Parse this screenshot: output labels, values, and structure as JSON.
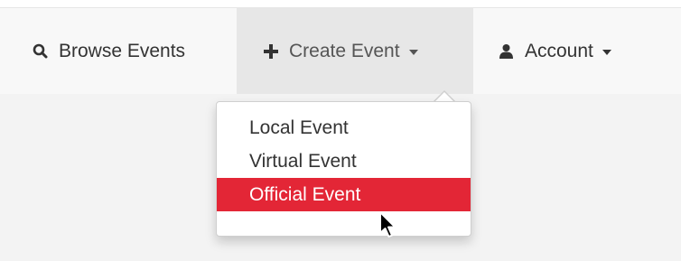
{
  "navbar": {
    "items": [
      {
        "label": "Browse Events",
        "icon": "search-icon"
      },
      {
        "label": "Create Event",
        "icon": "plus-icon"
      },
      {
        "label": "Account",
        "icon": "user-icon"
      }
    ]
  },
  "dropdown": {
    "items": [
      {
        "label": "Local Event"
      },
      {
        "label": "Virtual Event"
      },
      {
        "label": "Official Event",
        "state": "highlighted"
      }
    ]
  },
  "colors": {
    "highlight": "#e32636",
    "navbar_bg": "#f8f8f8",
    "active_nav_bg": "#e7e7e7",
    "content_bg": "#f3f3f3"
  }
}
